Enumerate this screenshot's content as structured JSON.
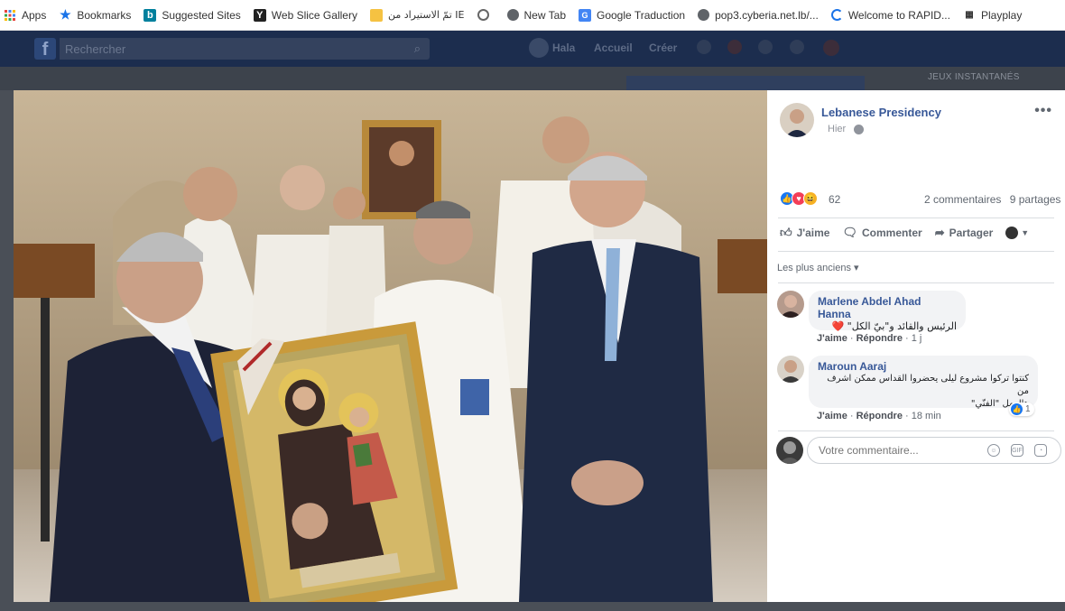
{
  "bookmarks": [
    {
      "label": "Apps",
      "icon": "apps-grid-icon"
    },
    {
      "label": "Bookmarks",
      "icon": "star-icon"
    },
    {
      "label": "Suggested Sites",
      "icon": "bing-icon"
    },
    {
      "label": "Web Slice Gallery",
      "icon": "web-slice-icon"
    },
    {
      "label": "تمّ الاستيراد من IE",
      "icon": "folder-icon"
    },
    {
      "label": "",
      "icon": "spiral-icon"
    },
    {
      "label": "New Tab",
      "icon": "globe-icon"
    },
    {
      "label": "Google Traduction",
      "icon": "translate-icon"
    },
    {
      "label": "pop3.cyberia.net.lb/...",
      "icon": "globe-icon"
    },
    {
      "label": "Welcome to RAPID...",
      "icon": "rapid-icon"
    },
    {
      "label": "Playplay",
      "icon": "playplay-icon"
    }
  ],
  "fb": {
    "logo": "f",
    "search_placeholder": "Rechercher",
    "nav": [
      "Hala",
      "Accueil",
      "Créer"
    ]
  },
  "backstrip": {
    "jeux": "JEUX INSTANTANÉS"
  },
  "post": {
    "page_name": "Lebanese Presidency",
    "time": "Hier",
    "more": "•••",
    "reaction_count": "62",
    "comments": "2 commentaires",
    "shares": "9 partages",
    "actions": {
      "like": "J'aime",
      "comment": "Commenter",
      "share": "Partager"
    },
    "sort_label": "Les plus anciens ▾",
    "write_placeholder": "Votre commentaire..."
  },
  "comments": [
    {
      "name": "Marlene Abdel Ahad Hanna",
      "text": "الرئيس والقائد و\"بيّ الكل\" ❤️",
      "like": "J'aime",
      "reply": "Répondre",
      "time": "1 j"
    },
    {
      "name": "Maroun Aaraj",
      "text_line1": "كنتوا تركوا مشروع ليلى يحضروا القداس ممكن اشرف من",
      "text_line2": "هالعمل \"الفنّي\"",
      "like": "J'aime",
      "reply": "Répondre",
      "time": "18 min",
      "likes": "1"
    }
  ],
  "colors": {
    "fb_blue": "#385898",
    "fb_bar": "#1c2d4e",
    "like_blue": "#1877f2",
    "heart_red": "#f33e58",
    "haha_yellow": "#f7b125"
  }
}
